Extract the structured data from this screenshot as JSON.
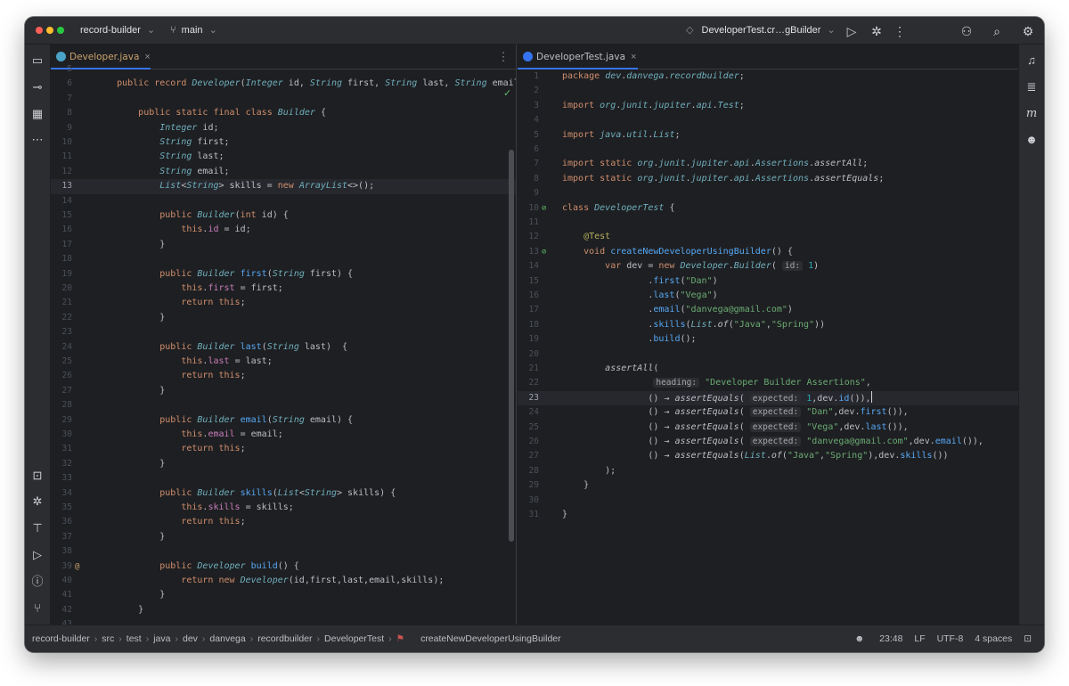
{
  "titlebar": {
    "project": "record-builder",
    "branch": "main",
    "run_config": "DeveloperTest.cr…gBuilder",
    "icons": [
      "folder-branch-icon",
      "run-icon",
      "debug-icon",
      "more-icon",
      "add-user-icon",
      "search-icon",
      "settings-icon"
    ]
  },
  "left_tab": {
    "name": "Developer.java",
    "badge_color": "#4aa3c7"
  },
  "right_tab": {
    "name": "DeveloperTest.java",
    "badge_color": "#3574f0"
  },
  "left_code": {
    "lines": [
      {
        "num": "5",
        "text": ""
      },
      {
        "num": "6",
        "text": "    public record Developer(Integer id, String first, String last, String email, Li"
      },
      {
        "num": "7",
        "text": ""
      },
      {
        "num": "8",
        "text": "        public static final class Builder {"
      },
      {
        "num": "9",
        "text": "            Integer id;"
      },
      {
        "num": "10",
        "text": "            String first;"
      },
      {
        "num": "11",
        "text": "            String last;"
      },
      {
        "num": "12",
        "text": "            String email;"
      },
      {
        "num": "13",
        "text": "            List<String> skills = new ArrayList<>();"
      },
      {
        "num": "14",
        "text": ""
      },
      {
        "num": "15",
        "text": "            public Builder(int id) {"
      },
      {
        "num": "16",
        "text": "                this.id = id;"
      },
      {
        "num": "17",
        "text": "            }"
      },
      {
        "num": "18",
        "text": ""
      },
      {
        "num": "19",
        "text": "            public Builder first(String first) {"
      },
      {
        "num": "20",
        "text": "                this.first = first;"
      },
      {
        "num": "21",
        "text": "                return this;"
      },
      {
        "num": "22",
        "text": "            }"
      },
      {
        "num": "23",
        "text": ""
      },
      {
        "num": "24",
        "text": "            public Builder last(String last)  {"
      },
      {
        "num": "25",
        "text": "                this.last = last;"
      },
      {
        "num": "26",
        "text": "                return this;"
      },
      {
        "num": "27",
        "text": "            }"
      },
      {
        "num": "28",
        "text": ""
      },
      {
        "num": "29",
        "text": "            public Builder email(String email) {"
      },
      {
        "num": "30",
        "text": "                this.email = email;"
      },
      {
        "num": "31",
        "text": "                return this;"
      },
      {
        "num": "32",
        "text": "            }"
      },
      {
        "num": "33",
        "text": ""
      },
      {
        "num": "34",
        "text": "            public Builder skills(List<String> skills) {"
      },
      {
        "num": "35",
        "text": "                this.skills = skills;"
      },
      {
        "num": "36",
        "text": "                return this;"
      },
      {
        "num": "37",
        "text": "            }"
      },
      {
        "num": "38",
        "text": ""
      },
      {
        "num": "39",
        "text": "            public Developer build() {"
      },
      {
        "num": "40",
        "text": "                return new Developer(id,first,last,email,skills);"
      },
      {
        "num": "41",
        "text": "            }"
      },
      {
        "num": "42",
        "text": "        }"
      },
      {
        "num": "43",
        "text": ""
      }
    ]
  },
  "right_code": {
    "lines": [
      {
        "num": "1",
        "text": "package dev.danvega.recordbuilder;"
      },
      {
        "num": "2",
        "text": ""
      },
      {
        "num": "3",
        "text": "import org.junit.jupiter.api.Test;"
      },
      {
        "num": "4",
        "text": ""
      },
      {
        "num": "5",
        "text": "import java.util.List;"
      },
      {
        "num": "6",
        "text": ""
      },
      {
        "num": "7",
        "text": "import static org.junit.jupiter.api.Assertions.assertAll;"
      },
      {
        "num": "8",
        "text": "import static org.junit.jupiter.api.Assertions.assertEquals;"
      },
      {
        "num": "9",
        "text": ""
      },
      {
        "num": "10",
        "text": "class DeveloperTest {"
      },
      {
        "num": "11",
        "text": ""
      },
      {
        "num": "12",
        "text": "    @Test"
      },
      {
        "num": "13",
        "text": "    void createNewDeveloperUsingBuilder() {"
      },
      {
        "num": "14",
        "text": "        var dev = new Developer.Builder( id: 1)"
      },
      {
        "num": "15",
        "text": "                .first(\"Dan\")"
      },
      {
        "num": "16",
        "text": "                .last(\"Vega\")"
      },
      {
        "num": "17",
        "text": "                .email(\"danvega@gmail.com\")"
      },
      {
        "num": "18",
        "text": "                .skills(List.of(\"Java\",\"Spring\"))"
      },
      {
        "num": "19",
        "text": "                .build();"
      },
      {
        "num": "20",
        "text": ""
      },
      {
        "num": "21",
        "text": "        assertAll("
      },
      {
        "num": "22",
        "text": "                 heading: \"Developer Builder Assertions\","
      },
      {
        "num": "23",
        "text": "                () → assertEquals( expected: 1,dev.id()),"
      },
      {
        "num": "24",
        "text": "                () → assertEquals( expected: \"Dan\",dev.first()),"
      },
      {
        "num": "25",
        "text": "                () → assertEquals( expected: \"Vega\",dev.last()),"
      },
      {
        "num": "26",
        "text": "                () → assertEquals( expected: \"danvega@gmail.com\",dev.email()),"
      },
      {
        "num": "27",
        "text": "                () → assertEquals(List.of(\"Java\",\"Spring\"),dev.skills())"
      },
      {
        "num": "28",
        "text": "        );"
      },
      {
        "num": "29",
        "text": "    }"
      },
      {
        "num": "30",
        "text": ""
      },
      {
        "num": "31",
        "text": "}"
      }
    ]
  },
  "statusbar": {
    "breadcrumbs": [
      "record-builder",
      "src",
      "test",
      "java",
      "dev",
      "danvega",
      "recordbuilder",
      "DeveloperTest"
    ],
    "method": "createNewDeveloperUsingBuilder",
    "position": "23:48",
    "line_sep": "LF",
    "encoding": "UTF-8",
    "indent": "4 spaces"
  }
}
